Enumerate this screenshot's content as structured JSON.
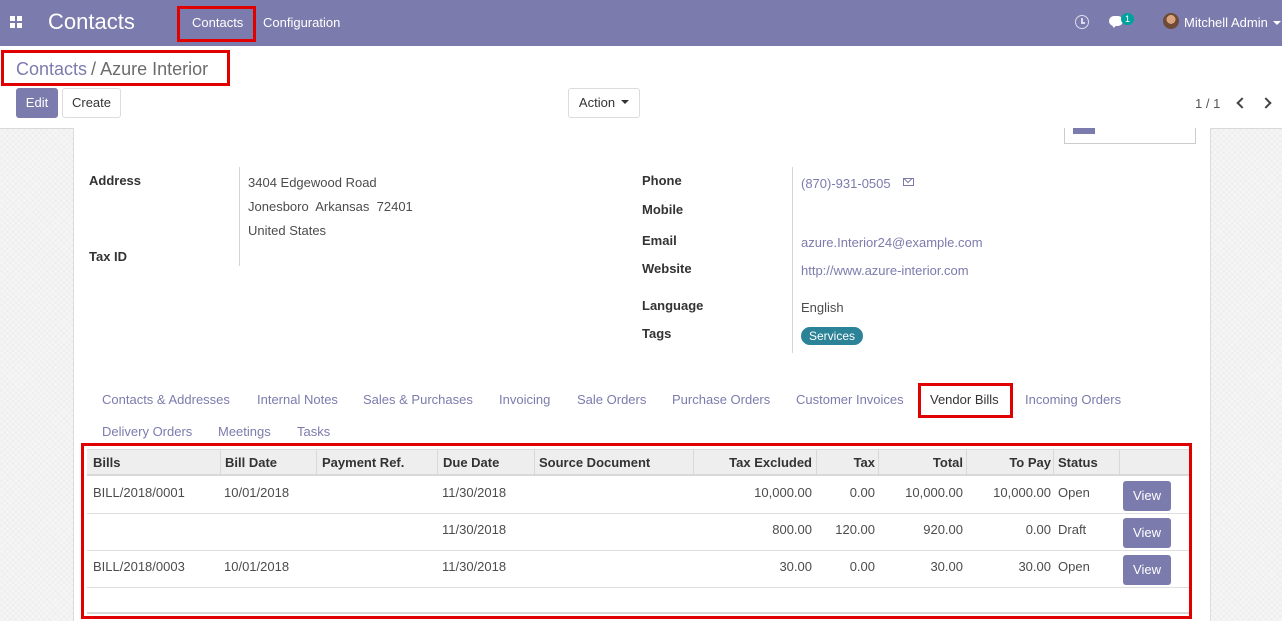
{
  "navbar": {
    "brand": "Contacts",
    "menu": [
      "Contacts",
      "Configuration"
    ],
    "chat_badge": "1",
    "user": "Mitchell Admin"
  },
  "breadcrumb": {
    "parent": "Contacts",
    "separator": "/",
    "current": "Azure Interior"
  },
  "buttons": {
    "edit": "Edit",
    "create": "Create",
    "action": "Action"
  },
  "pager": {
    "text": "1 / 1"
  },
  "contact": {
    "address_label": "Address",
    "address_lines": [
      "3404 Edgewood Road",
      "Jonesboro  Arkansas  72401",
      "United States"
    ],
    "tax_id_label": "Tax ID",
    "phone_label": "Phone",
    "phone": "(870)-931-0505",
    "mobile_label": "Mobile",
    "email_label": "Email",
    "email": "azure.Interior24@example.com",
    "website_label": "Website",
    "website": "http://www.azure-interior.com",
    "language_label": "Language",
    "language": "English",
    "tags_label": "Tags",
    "tags": [
      "Services"
    ]
  },
  "tabs": [
    "Contacts & Addresses",
    "Internal Notes",
    "Sales & Purchases",
    "Invoicing",
    "Sale Orders",
    "Purchase Orders",
    "Customer Invoices",
    "Vendor Bills",
    "Incoming Orders",
    "Delivery Orders",
    "Meetings",
    "Tasks"
  ],
  "active_tab": "Vendor Bills",
  "table": {
    "columns": [
      "Bills",
      "Bill Date",
      "Payment Ref.",
      "Due Date",
      "Source Document",
      "Tax Excluded",
      "Tax",
      "Total",
      "To Pay",
      "Status"
    ],
    "rows": [
      {
        "bill": "BILL/2018/0001",
        "bill_date": "10/01/2018",
        "payment_ref": "",
        "due_date": "11/30/2018",
        "source": "",
        "tax_excluded": "10,000.00",
        "tax": "0.00",
        "total": "10,000.00",
        "to_pay": "10,000.00",
        "status": "Open",
        "action": "View"
      },
      {
        "bill": "",
        "bill_date": "",
        "payment_ref": "",
        "due_date": "11/30/2018",
        "source": "",
        "tax_excluded": "800.00",
        "tax": "120.00",
        "total": "920.00",
        "to_pay": "0.00",
        "status": "Draft",
        "action": "View"
      },
      {
        "bill": "BILL/2018/0003",
        "bill_date": "10/01/2018",
        "payment_ref": "",
        "due_date": "11/30/2018",
        "source": "",
        "tax_excluded": "30.00",
        "tax": "0.00",
        "total": "30.00",
        "to_pay": "30.00",
        "status": "Open",
        "action": "View"
      }
    ]
  },
  "colors": {
    "brand": "#7c7bad",
    "highlight": "#e00000",
    "tag": "#2c8397",
    "badge": "#00a09d"
  },
  "icons": [
    "apps-icon",
    "clock-icon",
    "chat-icon",
    "envelope-icon",
    "chevron-left-icon",
    "chevron-right-icon",
    "caret-down-icon"
  ]
}
